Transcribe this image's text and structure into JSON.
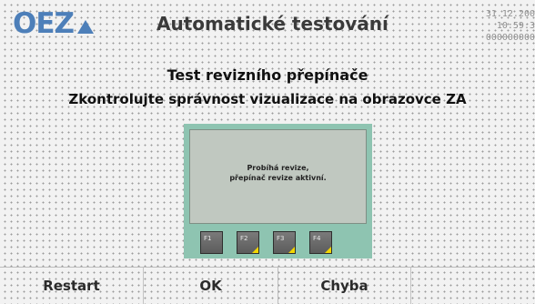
{
  "header": {
    "logo_text": "OEZ",
    "title": "Automatické testování",
    "date": "31.12.200",
    "time": "10:59:3",
    "counter": "000000000"
  },
  "main": {
    "heading": "Test revizního přepínače",
    "instruction": "Zkontrolujte správnost vizualizace na obrazovce ZA"
  },
  "panel": {
    "message_line1": "Probíhá revize,",
    "message_line2": "přepínač revize aktivní.",
    "keys": [
      "F1",
      "F2",
      "F3",
      "F4"
    ]
  },
  "footer": {
    "restart_label": "Restart",
    "ok_label": "OK",
    "chyba_label": "Chyba"
  },
  "colors": {
    "brand_blue": "#4d7fb9",
    "panel_green": "#8ec4b1",
    "key_marker": "#f2d600"
  }
}
